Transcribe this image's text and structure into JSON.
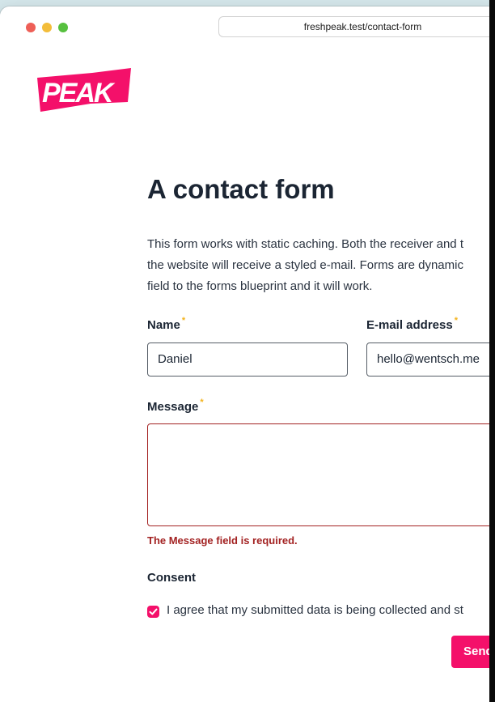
{
  "browser": {
    "url": "freshpeak.test/contact-form"
  },
  "logo": {
    "text": "PEAK",
    "color": "#f4106a"
  },
  "page": {
    "title": "A contact form",
    "intro_lines": [
      "This form works with static caching. Both the receiver and t",
      "the website will receive a styled e-mail. Forms are dynamic",
      "field to the forms blueprint and it will work."
    ]
  },
  "form": {
    "name": {
      "label": "Name",
      "value": "Daniel",
      "required_mark": "*"
    },
    "email": {
      "label": "E-mail address",
      "value": "hello@wentsch.me",
      "required_mark": "*"
    },
    "message": {
      "label": "Message",
      "value": "",
      "required_mark": "*",
      "error": "The Message field is required."
    },
    "consent": {
      "heading": "Consent",
      "text": "I agree that my submitted data is being collected and st",
      "checked": true
    },
    "submit_label": "Send"
  },
  "colors": {
    "accent": "#f4106a",
    "error": "#a32222",
    "required": "#f3b21b"
  }
}
